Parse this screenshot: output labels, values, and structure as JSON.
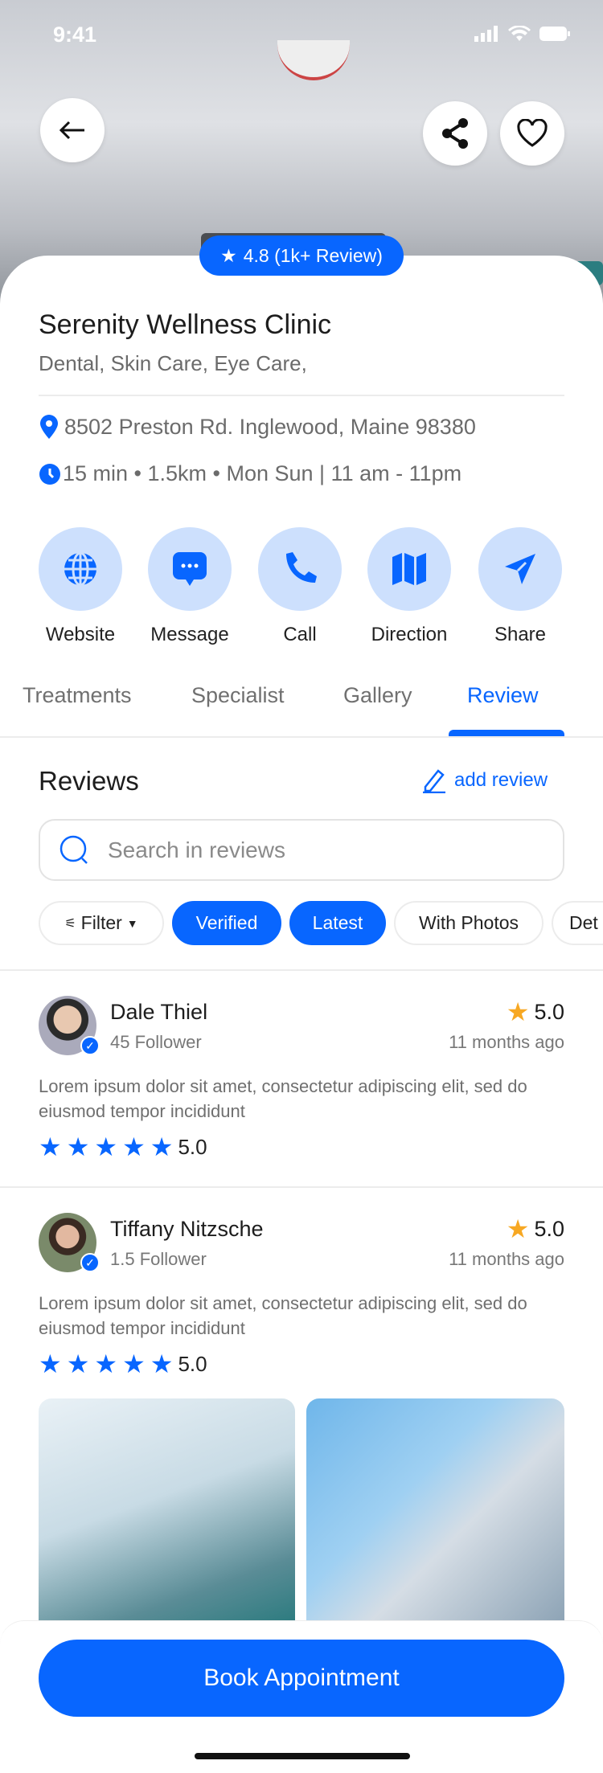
{
  "status_bar": {
    "time": "9:41"
  },
  "hero": {
    "rating_badge": "4.8 (1k+ Review)"
  },
  "clinic": {
    "name": "Serenity Wellness Clinic",
    "categories": "Dental, Skin Care, Eye Care,",
    "address": "8502 Preston Rd. Inglewood, Maine 98380",
    "hours": "15 min • 1.5km • Mon Sun | 11 am - 11pm"
  },
  "actions": [
    {
      "label": "Website"
    },
    {
      "label": "Message"
    },
    {
      "label": "Call"
    },
    {
      "label": "Direction"
    },
    {
      "label": "Share"
    }
  ],
  "tabs": [
    {
      "label": "Treatments"
    },
    {
      "label": "Specialist"
    },
    {
      "label": "Gallery"
    },
    {
      "label": "Review"
    }
  ],
  "reviews_section": {
    "title": "Reviews",
    "add_review": "add review",
    "search_placeholder": "Search in reviews",
    "chips": [
      {
        "label": "Filter"
      },
      {
        "label": "Verified"
      },
      {
        "label": "Latest"
      },
      {
        "label": "With Photos"
      },
      {
        "label": "Det"
      }
    ]
  },
  "reviews": [
    {
      "name": "Dale Thiel",
      "followers": "45 Follower",
      "rating": "5.0",
      "time": "11 months ago",
      "text": "Lorem ipsum dolor sit amet, consectetur adipiscing elit, sed do eiusmod tempor incididunt",
      "score": "5.0"
    },
    {
      "name": "Tiffany Nitzsche",
      "followers": "1.5 Follower",
      "rating": "5.0",
      "time": "11 months ago",
      "text": "Lorem ipsum dolor sit amet, consectetur adipiscing elit, sed do eiusmod tempor incididunt",
      "score": "5.0"
    }
  ],
  "footer": {
    "book_label": "Book Appointment"
  },
  "colors": {
    "accent": "#0866ff",
    "accent_light": "#cde0fd",
    "star_gold": "#f7a823"
  }
}
